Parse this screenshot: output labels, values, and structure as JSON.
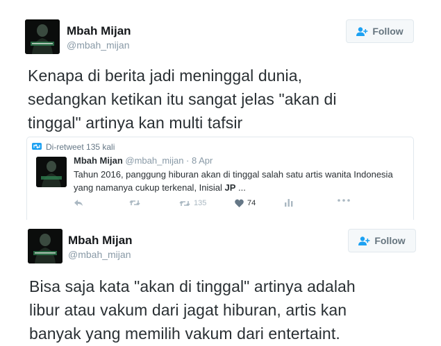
{
  "tweet1": {
    "name": "Mbah Mijan",
    "handle": "@mbah_mijan",
    "follow_label": "Follow",
    "text": "Kenapa di berita jadi meninggal dunia,\nsedangkan ketikan itu sangat jelas \"akan di\ntinggal\" artinya kan multi tafsir",
    "quoted": {
      "retweet_line": "Di-retweet 135 kali",
      "name": "Mbah Mijan",
      "meta": "@mbah_mijan · 8 Apr",
      "text_main": "Tahun 2016, panggung hiburan akan di tinggal salah satu artis wanita Indonesia\nyang namanya cukup terkenal, Inisial ",
      "text_bold": "JP",
      "text_tail": " ...",
      "retweet_count": "135",
      "like_count": "74"
    }
  },
  "tweet2": {
    "name": "Mbah Mijan",
    "handle": "@mbah_mijan",
    "follow_label": "Follow",
    "text": "Bisa saja kata \"akan di tinggal\" artinya adalah\nlibur atau vakum dari jagat hiburan, artis kan\nbanyak yang memilih vakum dari entertaint."
  },
  "colors": {
    "text": "#14171a",
    "muted": "#8899a6",
    "blue": "#1da1f2",
    "border": "#e1e8ed"
  },
  "icons": [
    "follow-person-icon",
    "retweet-icon",
    "reply-icon",
    "like-icon",
    "analytics-icon",
    "more-icon"
  ]
}
